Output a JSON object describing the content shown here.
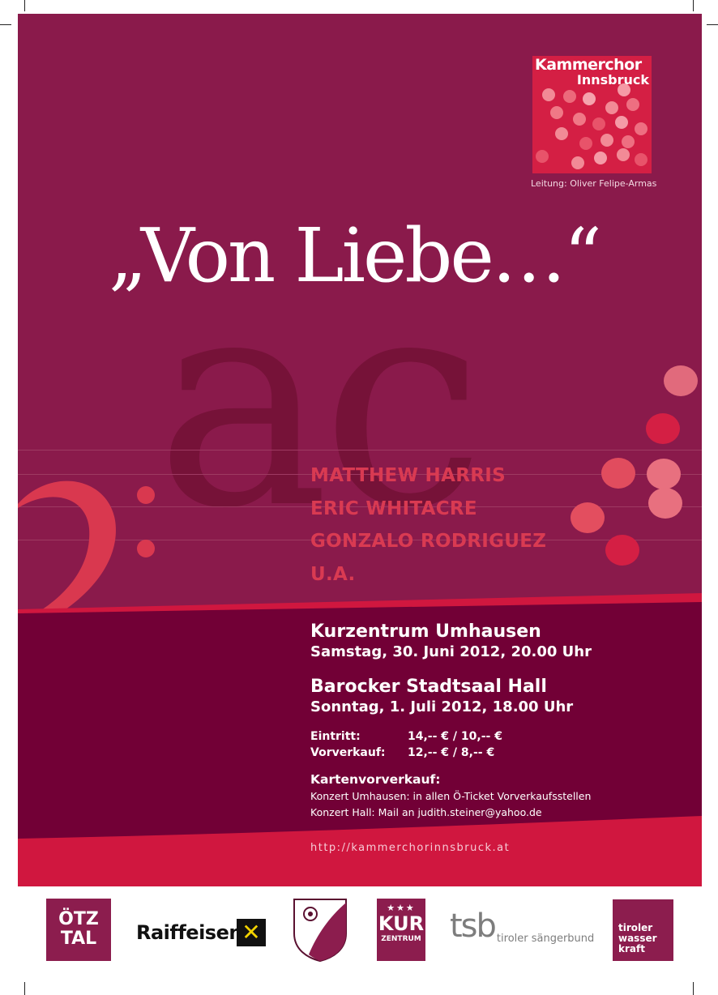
{
  "logo": {
    "line1": "Kammerchor",
    "line2": "Innsbruck",
    "leitung": "Leitung: Oliver Felipe-Armas"
  },
  "title": "„Von Liebe…“",
  "background_letters": "ac",
  "composers": [
    "MATTHEW HARRIS",
    "ERIC WHITACRE",
    "GONZALO RODRIGUEZ",
    "U.A."
  ],
  "events": [
    {
      "venue": "Kurzentrum Umhausen",
      "date": "Samstag, 30. Juni 2012, 20.00 Uhr"
    },
    {
      "venue": "Barocker Stadtsaal Hall",
      "date": "Sonntag, 1. Juli 2012, 18.00 Uhr"
    }
  ],
  "prices": [
    {
      "label": "Eintritt:",
      "value": "14,-- € / 10,-- €"
    },
    {
      "label": "Vorverkauf:",
      "value": "12,-- € / 8,-- €"
    }
  ],
  "kartenvorverkauf": {
    "title": "Kartenvorverkauf:",
    "lines": [
      "Konzert Umhausen: in allen Ö-Ticket Vorverkaufsstellen",
      "Konzert Hall: Mail an judith.steiner@yahoo.de"
    ]
  },
  "url": "http://kammerchorinnsbruck.at",
  "sponsors": {
    "oetztal": {
      "line1": "ÖTZ",
      "line2": "TAL"
    },
    "raiffeisen": "Raiffeisen",
    "kur": {
      "main": "KUR",
      "sub": "ZENTRUM"
    },
    "tsb": {
      "abbr": "tsb",
      "name": "tiroler sängerbund"
    },
    "tiroler": {
      "line1": "tiroler",
      "line2": "wasser",
      "line3": "kraft"
    }
  },
  "colors": {
    "background": "#8a1a4b",
    "dark_band": "#720036",
    "red_band": "#d0173f",
    "composer_text": "#d93a52"
  }
}
